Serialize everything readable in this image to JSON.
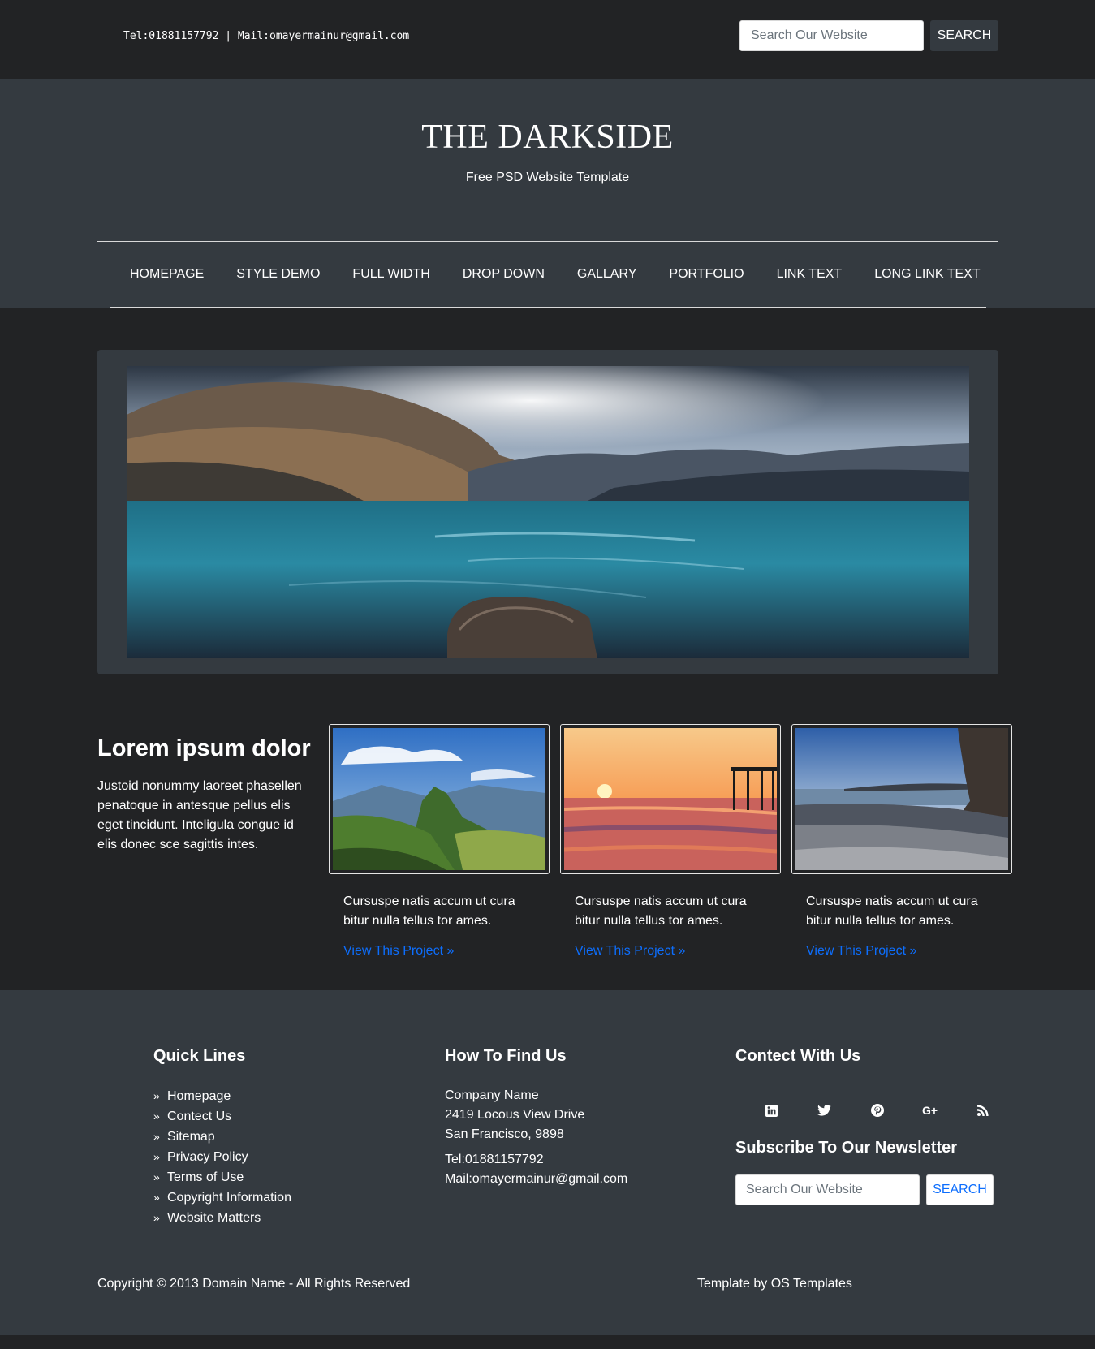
{
  "topbar": {
    "contact": "Tel:01881157792 | Mail:omayermainur@gmail.com",
    "search_placeholder": "Search Our Website",
    "search_button": "SEARCH"
  },
  "header": {
    "title": "THE DARKSIDE",
    "subtitle": "Free PSD Website Template"
  },
  "nav": {
    "items": [
      "HOMEPAGE",
      "STYLE DEMO",
      "FULL WIDTH",
      "DROP DOWN",
      "GALLARY",
      "PORTFOLIO",
      "LINK TEXT",
      "LONG LINK TEXT"
    ]
  },
  "intro": {
    "title": "Lorem ipsum dolor",
    "text": "Justoid nonummy laoreet phasellen penatoque in antesque pellus elis eget tincidunt. Inteligula congue id elis donec sce sagittis intes."
  },
  "cards": [
    {
      "text": "Cursuspe natis accum ut cura bitur nulla tellus tor ames.",
      "link": "View This Project »"
    },
    {
      "text": "Cursuspe natis accum ut cura bitur nulla tellus tor ames.",
      "link": "View This Project »"
    },
    {
      "text": "Cursuspe natis accum ut cura bitur nulla tellus tor ames.",
      "link": "View This Project »"
    }
  ],
  "footer": {
    "quick": {
      "heading": "Quick Lines",
      "items": [
        "Homepage",
        "Contect Us",
        "Sitemap",
        "Privacy Policy",
        "Terms of Use",
        "Copyright Information",
        "Website Matters"
      ]
    },
    "find": {
      "heading": "How To Find Us",
      "company": "Company Name",
      "street": "2419 Locous View Drive",
      "city": "San Francisco, 9898",
      "tel": "Tel:01881157792",
      "mail": "Mail:omayermainur@gmail.com"
    },
    "connect": {
      "heading": "Contect With Us",
      "icons": [
        "linkedin-icon",
        "twitter-icon",
        "pinterest-icon",
        "google-plus-icon",
        "rss-icon"
      ],
      "newsletter_heading": "Subscribe To Our Newsletter",
      "search_placeholder": "Search Our Website",
      "search_button": "SEARCH"
    },
    "copyright": "Copyright © 2013 Domain Name - All Rights Reserved",
    "credit": "Template by OS Templates"
  },
  "colors": {
    "dark_bg": "#222325",
    "panel_bg": "#343a40",
    "link_blue": "#0d6efd"
  }
}
